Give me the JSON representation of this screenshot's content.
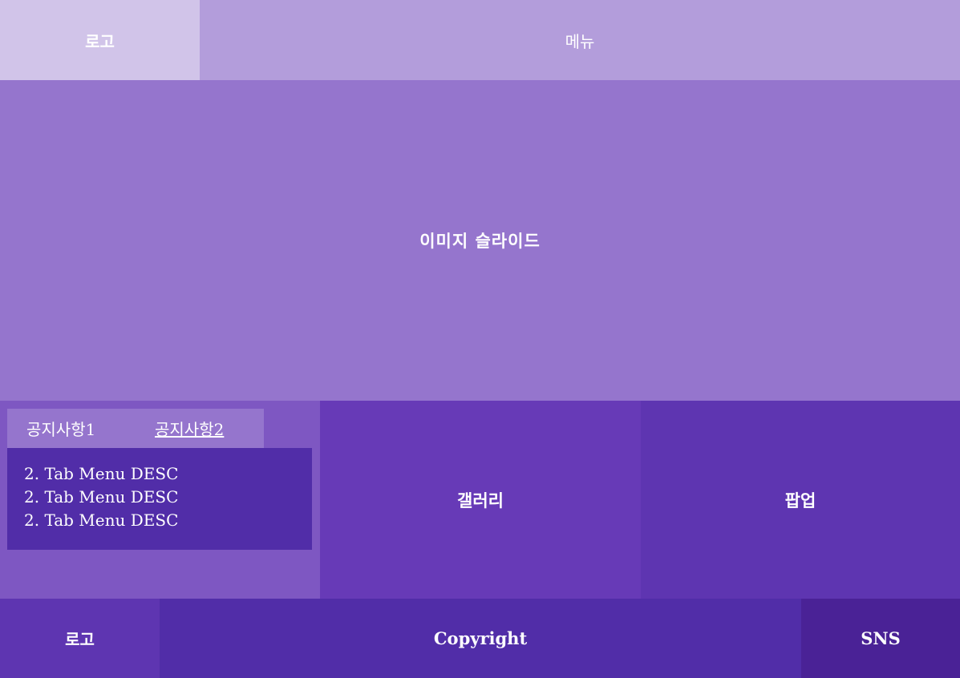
{
  "header": {
    "logo": "로고",
    "menu": "메뉴"
  },
  "slider": {
    "label": "이미지 슬라이드"
  },
  "notice": {
    "tabs": [
      "공지사항1",
      "공지사항2"
    ],
    "active_tab": 1,
    "items": [
      "2. Tab Menu DESC",
      "2. Tab Menu DESC",
      "2. Tab Menu DESC"
    ]
  },
  "gallery": {
    "label": "갤러리"
  },
  "popup": {
    "label": "팝업"
  },
  "footer": {
    "logo": "로고",
    "copyright": "Copyright",
    "sns": "SNS"
  },
  "colors": {
    "header_logo_bg": "#d1c4e9",
    "header_menu_bg": "#b39ddb",
    "slider_bg": "#9575cd",
    "notice_bg": "#7e57c2",
    "tab_desc_bg": "#512da8",
    "gallery_bg": "#673ab7",
    "popup_bg": "#5e35b1",
    "footer_copyright_bg": "#512da8",
    "footer_sns_bg": "#4a2296"
  }
}
